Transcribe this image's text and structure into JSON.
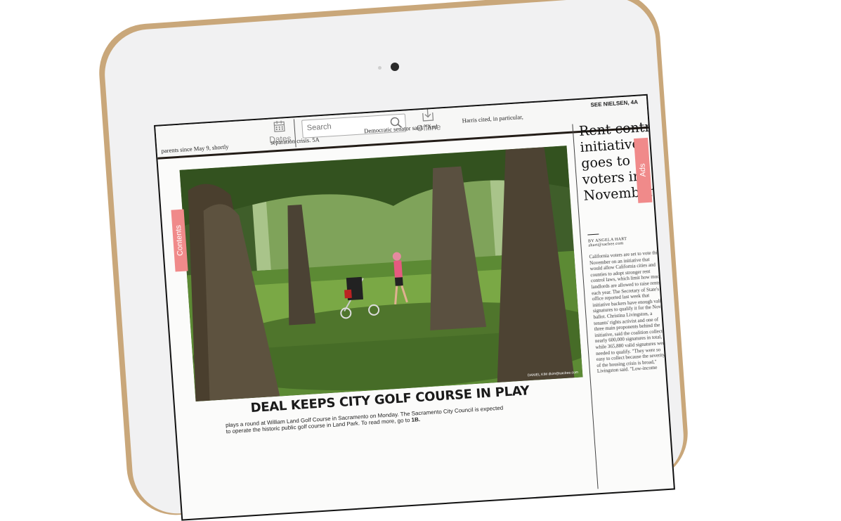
{
  "toolbar": {
    "dates_label": "Dates",
    "search_placeholder": "Search",
    "offline_label": "Offline"
  },
  "header_strip": {
    "col1_line1": "parents since May 9, shortly",
    "col2_line1": "separation crisis. 5A",
    "col3_line1": "Democratic senator said. \"And",
    "col4_line1": "Harris cited, in particular,",
    "col5_line1": "SEE NIELSEN, 4A"
  },
  "main_story": {
    "photo_credit": "DANIEL KIM  dkim@sacbee.com",
    "headline": "DEAL KEEPS CITY GOLF COURSE IN PLAY",
    "caption_prefix": "plays a round at William Land Golf Course in Sacramento on Monday. The Sacramento City Council is expected",
    "caption_line2": "to operate the historic public golf course in Land Park. To read more, go to",
    "caption_ref": "1B."
  },
  "side_story": {
    "headline": "Rent control initiative goes to voters in November",
    "byline": "BY ANGELA HART",
    "email": "ahart@sacbee.com",
    "body": "California voters are set to vote this November on an initiative that would allow California cities and counties to adopt stronger rent control laws, which limit how much landlords are allowed to raise rents each year. The Secretary of State's office reported last week that initiative backers have enough valid signatures to qualify it for the Nov. 6 ballot. Christina Livingston, a tenants' rights activist and one of three main proponents behind the initiative, said the coalition collected nearly 600,000 signatures in total, while 365,880 valid signatures were needed to qualify. \"They were so easy to collect because the severity of the housing crisis is broad,\" Livingston said. \"Low-income"
  },
  "tabs": {
    "contents": "Contents",
    "ads": "Ads"
  },
  "colors": {
    "tab_accent": "#f08a8a",
    "device_gold": "#c9a77a"
  }
}
